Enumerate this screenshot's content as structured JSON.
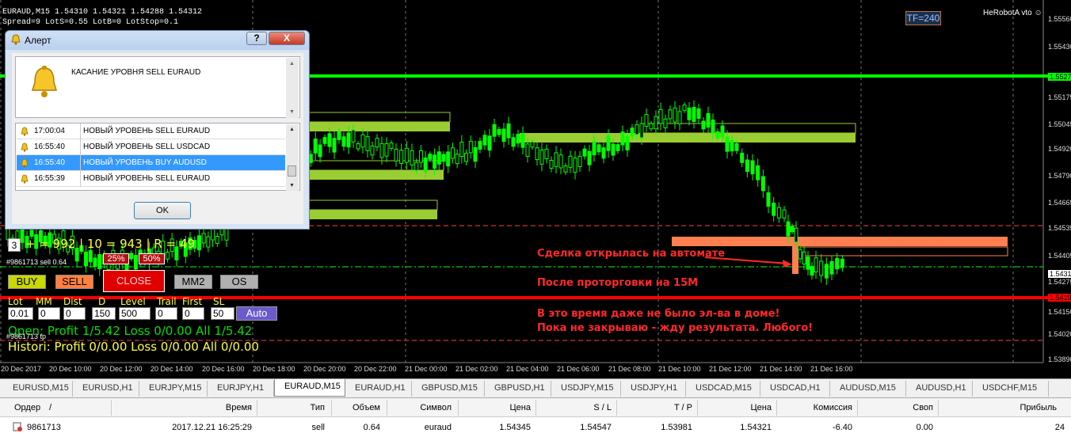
{
  "chart": {
    "symbol_line": "EURAUD,M15  1.54310 1.54321 1.54288 1.54312",
    "spread_line": "Spread=9  LotS=0.55  LotB=0  LotStop=0.1",
    "tf_badge": "TF=240",
    "brand": "HeRobotA vto",
    "price_axis": [
      "1.55560",
      "1.55430",
      "1.55275",
      "1.55175",
      "1.55045",
      "1.54920",
      "1.54790",
      "1.54665",
      "1.54535",
      "1.54405",
      "1.54312",
      "1.54275",
      "1.54190",
      "1.54150",
      "1.54020",
      "1.53890"
    ],
    "time_axis": [
      "20 Dec 2017",
      "20 Dec 10:00",
      "20 Dec 12:00",
      "20 Dec 14:00",
      "20 Dec 16:00",
      "20 Dec 18:00",
      "20 Dec 20:00",
      "20 Dec 22:00",
      "21 Dec 00:00",
      "21 Dec 02:00",
      "21 Dec 04:00",
      "21 Dec 06:00",
      "21 Dec 08:00",
      "21 Dec 10:00",
      "21 Dec 12:00",
      "21 Dec 14:00",
      "21 Dec 16:00"
    ],
    "annotations": [
      "Сделка открылась на автомате",
      "После проторговки на 15М",
      "В это время даже не было эл-ва в доме!",
      "Пока не закрываю - жду результата. Любого!"
    ],
    "colors": {
      "green_level": "#00ff00",
      "red_level": "#ff0000",
      "zone_green": "#9acd32",
      "zone_orange": "#ff7f50",
      "candle": "#00ff00"
    }
  },
  "panel": {
    "stats_prefix": "3",
    "stats": "+ = 992 | 10 = 943 | R = 49",
    "ticket_sell": "#9861713 sell 0.64",
    "ticket_tp": "#9861713 tp",
    "pct_left": "25%",
    "pct_right": "50%",
    "buttons": {
      "buy": "BUY",
      "sell": "SELL",
      "close": "CLOSE",
      "mm2": "MM2",
      "os": "OS",
      "auto": "Auto"
    },
    "param_labels": [
      "Lot",
      "MM",
      "Dist",
      "D",
      "Level",
      "Trail",
      "First",
      "SL"
    ],
    "param_values": [
      "0.01",
      "0",
      "0",
      "150",
      "500",
      "0",
      "0",
      "50"
    ],
    "open_line": "Open:  Profit 1/5.42  Loss 0/0.00  All 1/5.42",
    "hist_line": "Histori: Profit 0/0.00  Loss 0/0.00  All 0/0.00"
  },
  "alert": {
    "title": "Алерт",
    "help": "?",
    "close": "X",
    "message": "КАСАНИЕ УРОВНЯ SELL EURAUD",
    "rows": [
      {
        "time": "17:00:04",
        "msg": "НОВЫЙ УРОВЕНЬ SELL EURAUD"
      },
      {
        "time": "16:55:40",
        "msg": "НОВЫЙ УРОВЕНЬ SELL USDCAD"
      },
      {
        "time": "16:55:40",
        "msg": "НОВЫЙ УРОВЕНЬ BUY AUDUSD"
      },
      {
        "time": "16:55:39",
        "msg": "НОВЫЙ УРОВЕНЬ SELL EURAUD"
      }
    ],
    "selected_row": 2,
    "ok": "OK"
  },
  "tabs": [
    "EURUSD,M15",
    "EURUSD,H1",
    "EURJPY,M15",
    "EURJPY,H1",
    "EURAUD,M15",
    "EURAUD,H1",
    "GBPUSD,M15",
    "GBPUSD,H1",
    "USDJPY,M15",
    "USDJPY,H1",
    "USDCAD,M15",
    "USDCAD,H1",
    "AUDUSD,M15",
    "AUDUSD,H1",
    "USDCHF,M15"
  ],
  "active_tab": 4,
  "table": {
    "headers": [
      "Ордер",
      "/",
      "Время",
      "Тип",
      "Объем",
      "Символ",
      "Цена",
      "S / L",
      "T / P",
      "Цена",
      "Комиссия",
      "Своп",
      "Прибыль"
    ],
    "row": [
      "9861713",
      "2017.12.21 16:25:29",
      "sell",
      "0.64",
      "euraud",
      "1.54345",
      "1.54547",
      "1.53981",
      "1.54321",
      "-6.40",
      "0.00",
      "24"
    ]
  }
}
